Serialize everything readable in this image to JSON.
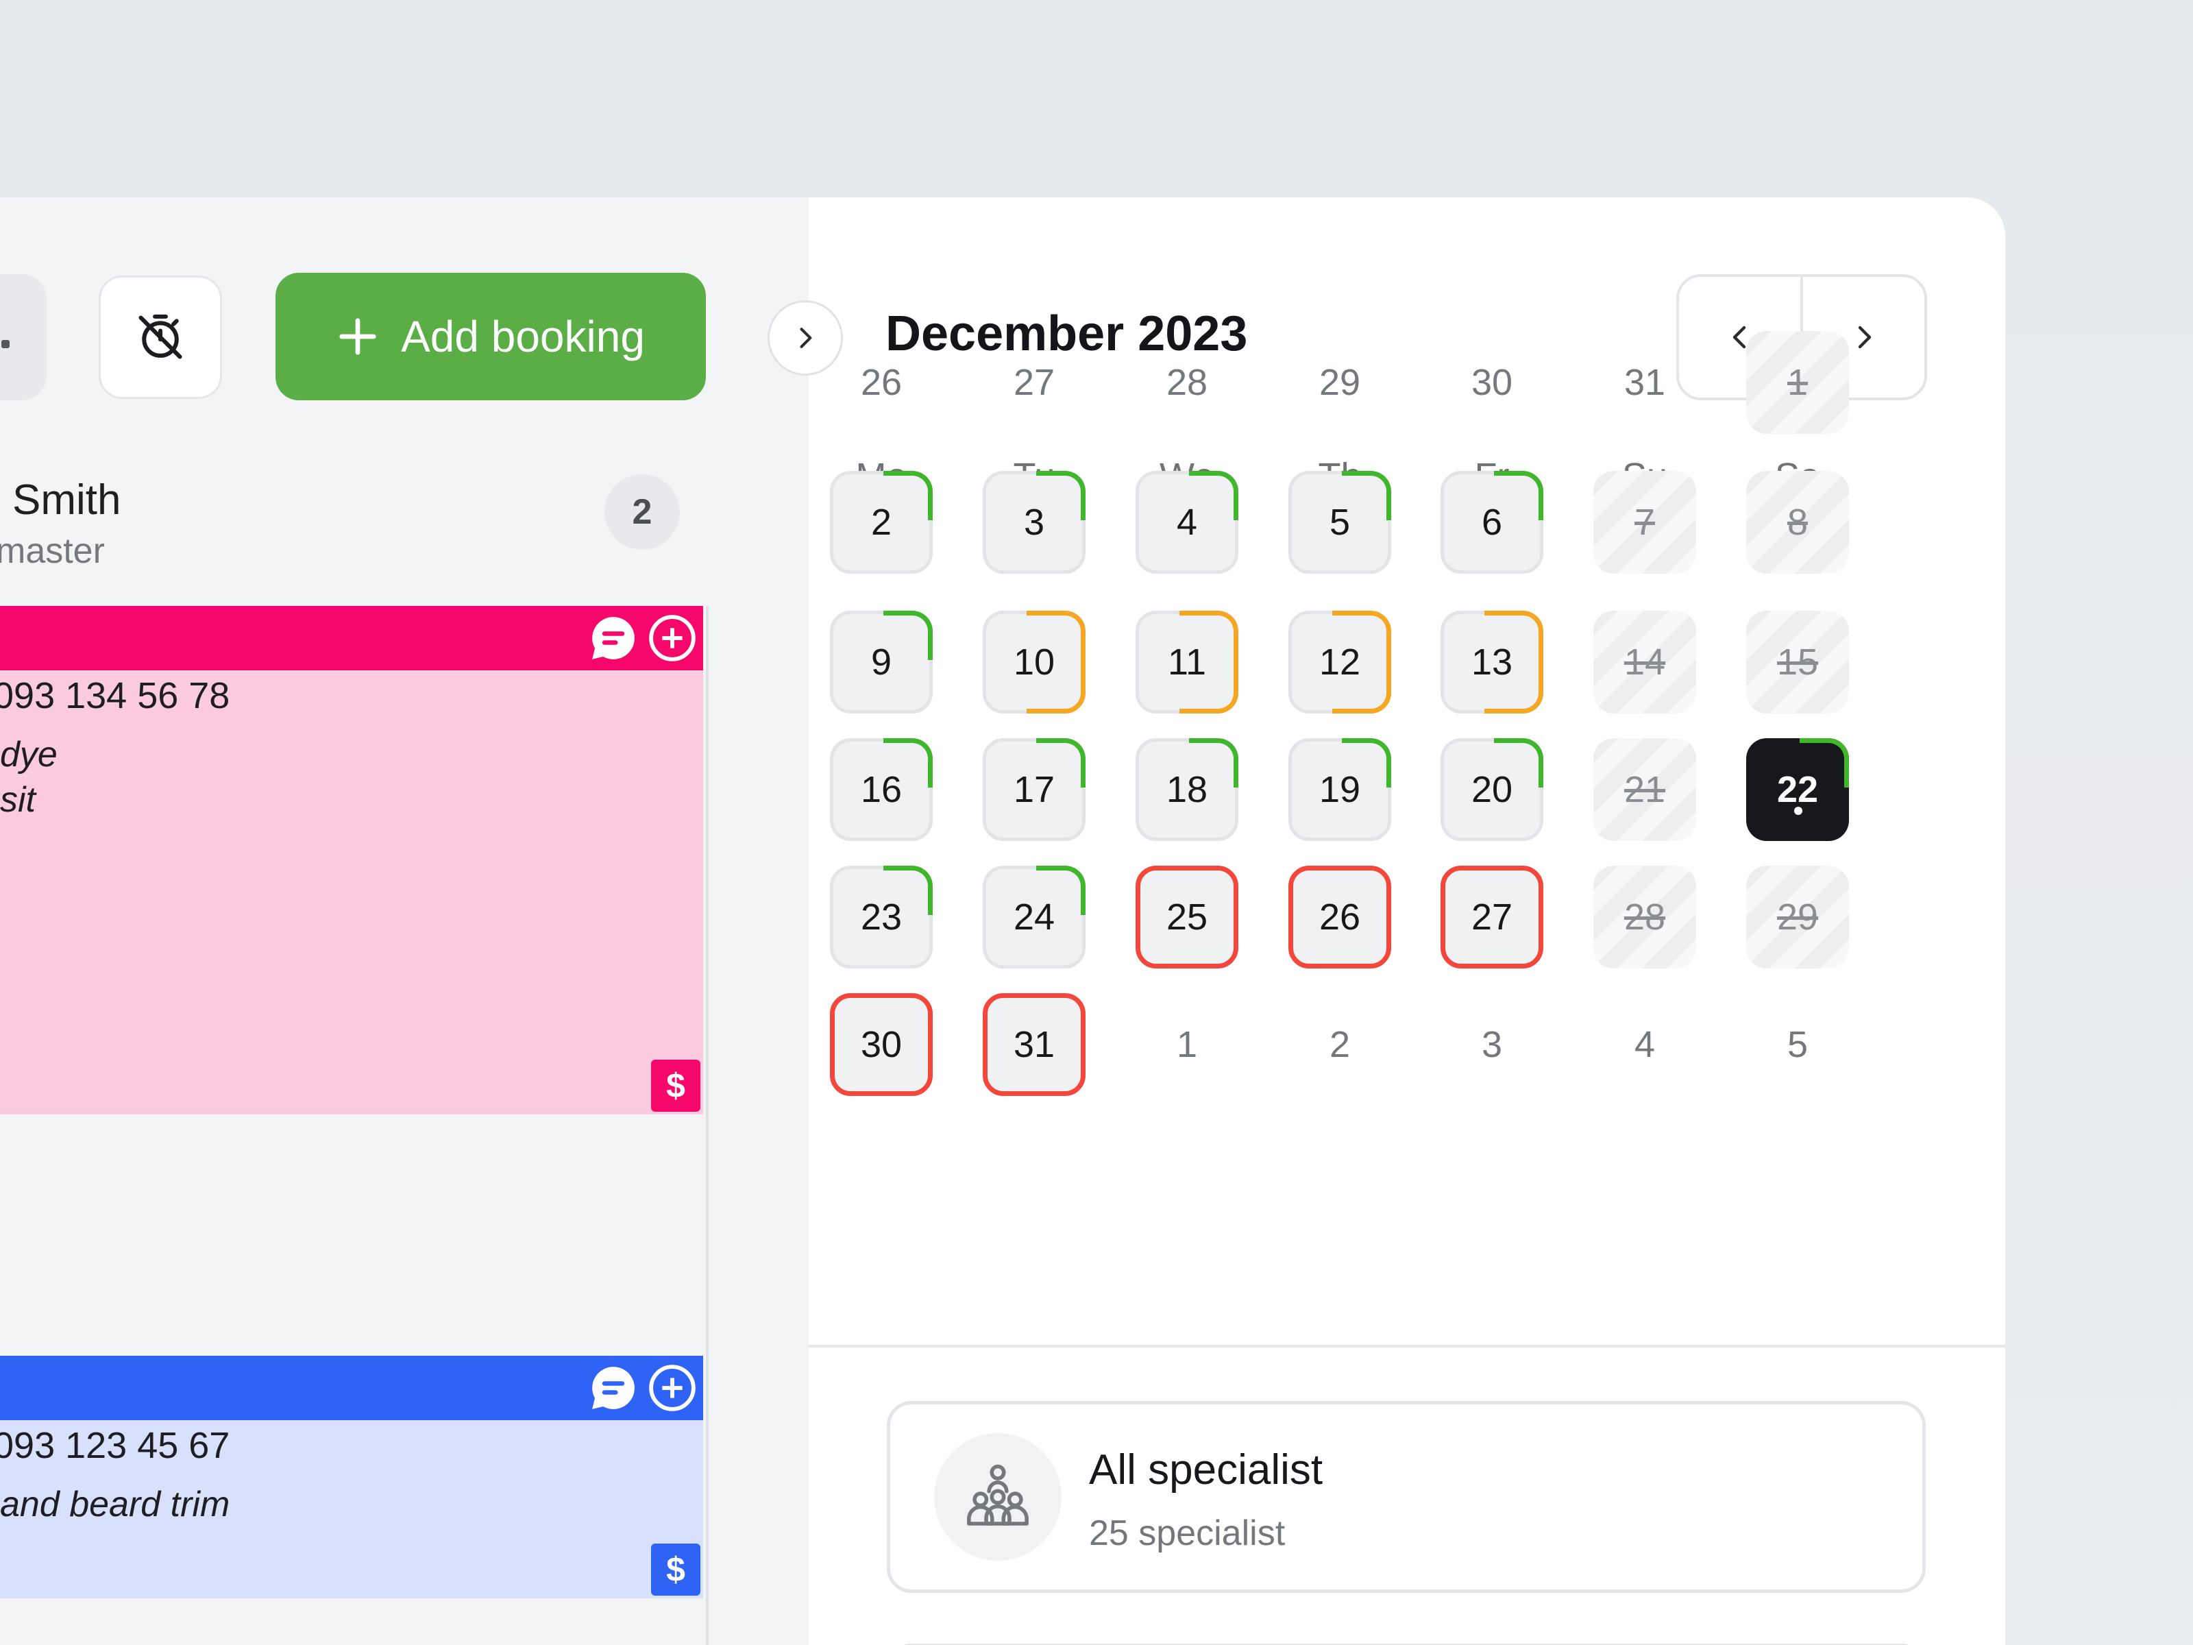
{
  "toolbar": {
    "add_booking_label": "Add booking",
    "timer_icon": "timer-off-icon",
    "add_icon": "plus-icon"
  },
  "staff": {
    "name": "Smith",
    "role": "master",
    "booking_count": "2"
  },
  "bookings": [
    {
      "color": "#f5076c",
      "background": "#fdcbe0",
      "phone": "093 134 56 78",
      "service_lines": [
        "dye",
        "sit"
      ],
      "payment_label": "$"
    },
    {
      "color": "#2f63f6",
      "background": "#d8e0fc",
      "phone": "093 123 45 67",
      "service_lines": [
        "and beard trim"
      ],
      "payment_label": "$"
    }
  ],
  "calendar": {
    "month_title": "December 2023",
    "prev_icon": "chevron-left-icon",
    "next_icon": "chevron-right-icon",
    "weekdays": [
      "Mo",
      "Tu",
      "We",
      "Th",
      "Fr",
      "Su",
      "Sa"
    ],
    "load_colors": {
      "low": "#3fb62b",
      "medium": "#f5a623",
      "full": "#f2473a"
    },
    "weeks": [
      [
        {
          "label": "26",
          "state": "other"
        },
        {
          "label": "27",
          "state": "other"
        },
        {
          "label": "28",
          "state": "other"
        },
        {
          "label": "29",
          "state": "other"
        },
        {
          "label": "30",
          "state": "other"
        },
        {
          "label": "31",
          "state": "other"
        },
        {
          "label": "1",
          "state": "closed"
        }
      ],
      [
        {
          "label": "2",
          "state": "low"
        },
        {
          "label": "3",
          "state": "low"
        },
        {
          "label": "4",
          "state": "low"
        },
        {
          "label": "5",
          "state": "low"
        },
        {
          "label": "6",
          "state": "low"
        },
        {
          "label": "7",
          "state": "closed"
        },
        {
          "label": "8",
          "state": "closed"
        }
      ],
      [
        {
          "label": "9",
          "state": "low"
        },
        {
          "label": "10",
          "state": "medium"
        },
        {
          "label": "11",
          "state": "medium"
        },
        {
          "label": "12",
          "state": "medium"
        },
        {
          "label": "13",
          "state": "medium"
        },
        {
          "label": "14",
          "state": "closed"
        },
        {
          "label": "15",
          "state": "closed"
        }
      ],
      [
        {
          "label": "16",
          "state": "low"
        },
        {
          "label": "17",
          "state": "low"
        },
        {
          "label": "18",
          "state": "low"
        },
        {
          "label": "19",
          "state": "low"
        },
        {
          "label": "20",
          "state": "low"
        },
        {
          "label": "21",
          "state": "closed"
        },
        {
          "label": "22",
          "state": "today"
        }
      ],
      [
        {
          "label": "23",
          "state": "low"
        },
        {
          "label": "24",
          "state": "low"
        },
        {
          "label": "25",
          "state": "full"
        },
        {
          "label": "26",
          "state": "full"
        },
        {
          "label": "27",
          "state": "full"
        },
        {
          "label": "28",
          "state": "closed"
        },
        {
          "label": "29",
          "state": "closed"
        }
      ],
      [
        {
          "label": "30",
          "state": "full"
        },
        {
          "label": "31",
          "state": "full"
        },
        {
          "label": "1",
          "state": "other"
        },
        {
          "label": "2",
          "state": "other"
        },
        {
          "label": "3",
          "state": "other"
        },
        {
          "label": "4",
          "state": "other"
        },
        {
          "label": "5",
          "state": "other"
        }
      ]
    ]
  },
  "specialists": {
    "title": "All specialist",
    "subtitle": "25 specialist",
    "icon": "group-icon"
  }
}
